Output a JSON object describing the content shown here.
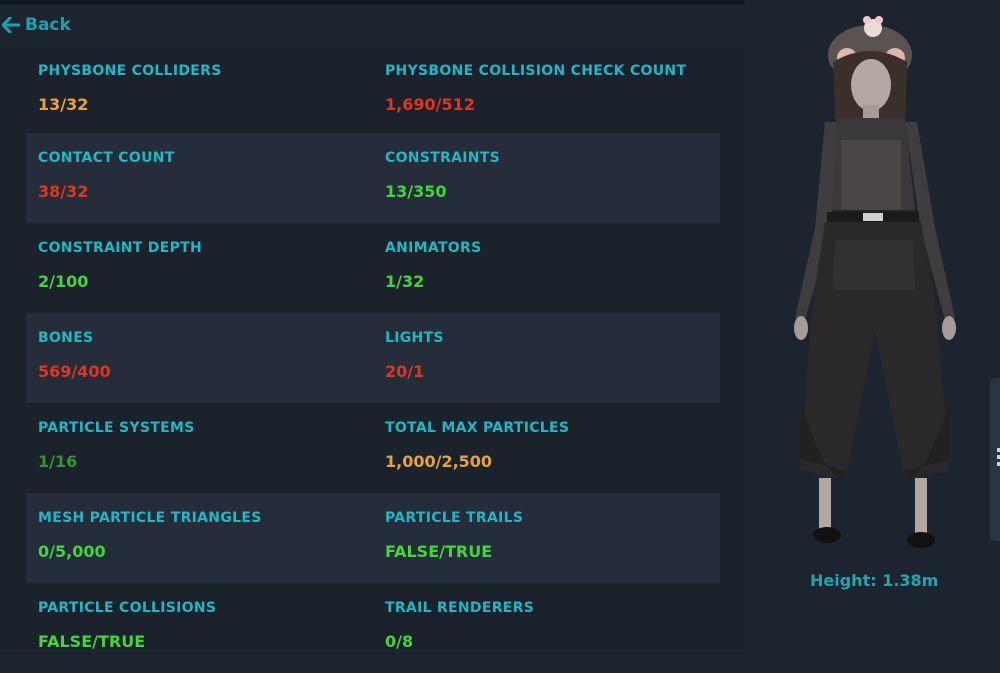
{
  "nav": {
    "back_label": "Back"
  },
  "colors": {
    "accent": "#1fb8c6",
    "orange": "#e8a33a",
    "red": "#e0361e",
    "green": "#42d63c",
    "dark_green": "#2f9a2a"
  },
  "rows": [
    {
      "alt": false,
      "cells": [
        {
          "label": "PHYSBONE COLLIDERS",
          "value": "13/32",
          "status": "orange"
        },
        {
          "label": "PHYSBONE COLLISION CHECK COUNT",
          "value": "1,690/512",
          "status": "red"
        }
      ]
    },
    {
      "alt": true,
      "cells": [
        {
          "label": "CONTACT COUNT",
          "value": "38/32",
          "status": "red"
        },
        {
          "label": "CONSTRAINTS",
          "value": "13/350",
          "status": "green"
        }
      ]
    },
    {
      "alt": false,
      "cells": [
        {
          "label": "CONSTRAINT DEPTH",
          "value": "2/100",
          "status": "green"
        },
        {
          "label": "ANIMATORS",
          "value": "1/32",
          "status": "green"
        }
      ]
    },
    {
      "alt": true,
      "cells": [
        {
          "label": "BONES",
          "value": "569/400",
          "status": "red"
        },
        {
          "label": "LIGHTS",
          "value": "20/1",
          "status": "red"
        }
      ]
    },
    {
      "alt": false,
      "cells": [
        {
          "label": "PARTICLE SYSTEMS",
          "value": "1/16",
          "status": "dark_green"
        },
        {
          "label": "TOTAL MAX PARTICLES",
          "value": "1,000/2,500",
          "status": "orange"
        }
      ]
    },
    {
      "alt": true,
      "cells": [
        {
          "label": "MESH PARTICLE TRIANGLES",
          "value": "0/5,000",
          "status": "green"
        },
        {
          "label": "PARTICLE TRAILS",
          "value": "FALSE/TRUE",
          "status": "green"
        }
      ]
    },
    {
      "alt": false,
      "cells": [
        {
          "label": "PARTICLE COLLISIONS",
          "value": "FALSE/TRUE",
          "status": "green"
        },
        {
          "label": "TRAIL RENDERERS",
          "value": "0/8",
          "status": "green"
        }
      ]
    }
  ],
  "avatar": {
    "height_label": "Height: 1.38m"
  }
}
